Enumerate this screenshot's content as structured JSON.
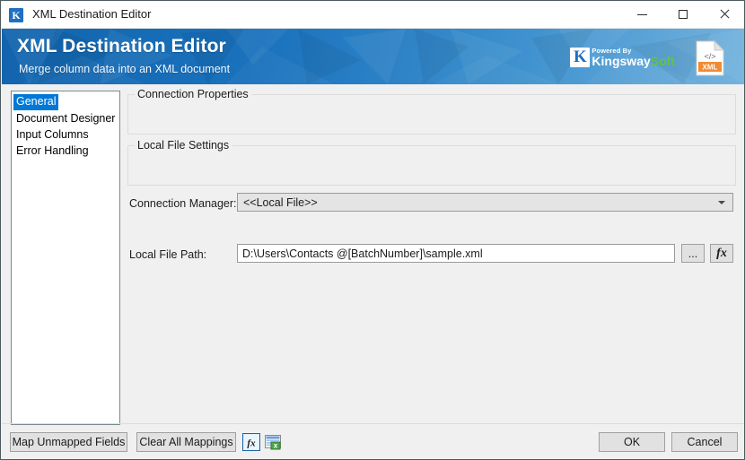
{
  "window": {
    "title": "XML Destination Editor",
    "app_icon": "kingswaysoft-k-icon",
    "controls": {
      "minimize": "minimize-icon",
      "maximize": "maximize-icon",
      "close": "close-icon"
    }
  },
  "banner": {
    "title": "XML Destination Editor",
    "subtitle": "Merge column data into an XML document",
    "logo": {
      "mark": "K",
      "powered_by": "Powered By",
      "brand_first": "Kingsway",
      "brand_second": "Soft"
    },
    "file_icon": {
      "code_glyph": "</>",
      "badge": "XML"
    },
    "colors": {
      "blue_dark": "#1264ad",
      "blue_light": "#74b3de",
      "green": "#62c24a"
    }
  },
  "sidebar": {
    "items": [
      {
        "label": "General",
        "selected": true
      },
      {
        "label": "Document Designer",
        "selected": false
      },
      {
        "label": "Input Columns",
        "selected": false
      },
      {
        "label": "Error Handling",
        "selected": false
      }
    ],
    "selected_color": "#0078d7"
  },
  "main": {
    "connection_properties": {
      "group_label": "Connection Properties",
      "connection_manager_label": "Connection Manager:",
      "connection_manager_value": "<<Local File>>",
      "chevron": "chevron-down-icon"
    },
    "local_file_settings": {
      "group_label": "Local File Settings",
      "local_file_path_label": "Local File Path:",
      "local_file_path_value": "D:\\Users\\Contacts @[BatchNumber]\\sample.xml",
      "browse_label": "...",
      "expression_label": "fx"
    }
  },
  "footer": {
    "map_unmapped_fields": "Map Unmapped Fields",
    "clear_all_mappings": "Clear All Mappings",
    "fx_icon": "expression-fx-icon",
    "export_icon": "export-grid-icon",
    "ok": "OK",
    "cancel": "Cancel"
  }
}
